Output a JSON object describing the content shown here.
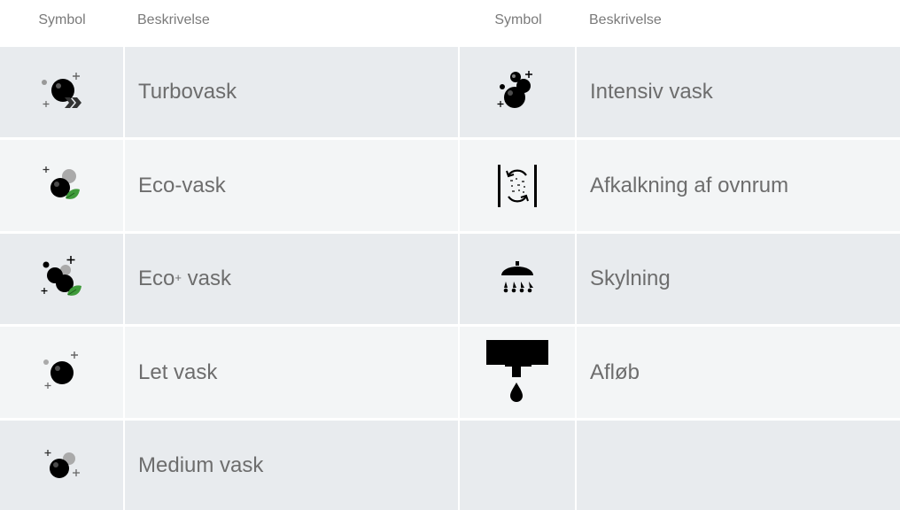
{
  "table": {
    "left_header": {
      "symbol": "Symbol",
      "description": "Beskrivelse"
    },
    "right_header": {
      "symbol": "Symbol",
      "description": "Beskrivelse"
    },
    "rows": [
      {
        "left": {
          "icon": "turbo-wash-icon",
          "label": "Turbovask"
        },
        "right": {
          "icon": "intensive-wash-icon",
          "label": "Intensiv vask"
        }
      },
      {
        "left": {
          "icon": "eco-wash-icon",
          "label": "Eco-vask"
        },
        "right": {
          "icon": "oven-descaling-icon",
          "label": "Afkalkning af ovnrum"
        }
      },
      {
        "left": {
          "icon": "eco-plus-wash-icon",
          "label_base": "Eco",
          "label_sup": "+",
          "label_rest": " vask"
        },
        "right": {
          "icon": "rinse-shower-icon",
          "label": "Skylning"
        }
      },
      {
        "left": {
          "icon": "light-wash-icon",
          "label": "Let vask"
        },
        "right": {
          "icon": "drain-icon",
          "label": "Afløb"
        }
      },
      {
        "left": {
          "icon": "medium-wash-icon",
          "label": "Medium vask"
        },
        "right": null
      }
    ]
  },
  "colors": {
    "row_dark": "#e8ebee",
    "row_light": "#f3f5f6",
    "text": "#6d6d6d",
    "header_text": "#7a7a7a",
    "leaf_green": "#3f9b3a"
  }
}
